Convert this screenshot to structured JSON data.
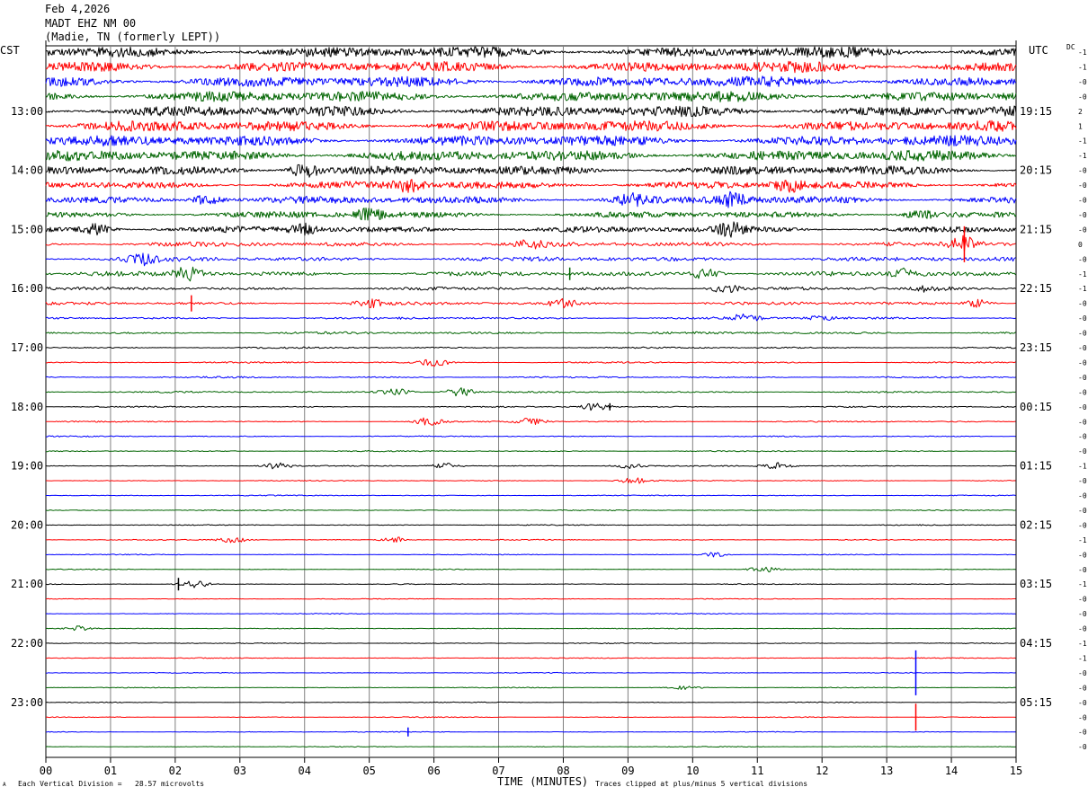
{
  "header": {
    "date": "Feb 4,2026",
    "station": "MADT EHZ NM 00",
    "location": "(Madie, TN (formerly LEPT))"
  },
  "left_zone_label": "CST",
  "right_zone_label": "UTC",
  "dc_label": "DC",
  "footer": {
    "scale_note": "Each Vertical Division =   28.57 microvolts",
    "clip_note": "Traces clipped at plus/minus 5 vertical divisions",
    "corner_mark": "A"
  },
  "colors": {
    "trace_cycle": [
      "#000000",
      "#ff0000",
      "#0000ff",
      "#006400"
    ],
    "grid": "#808080"
  },
  "chart_data": {
    "type": "line",
    "title": "Feb 4,2026 MADT EHZ NM 00 (Madie, TN (formerly LEPT))",
    "xlabel": "TIME (MINUTES)",
    "ylabel": "",
    "x_range": [
      0,
      15
    ],
    "x_tick_labels": [
      "00",
      "01",
      "02",
      "03",
      "04",
      "05",
      "06",
      "07",
      "08",
      "09",
      "10",
      "11",
      "12",
      "13",
      "14",
      "15"
    ],
    "grid": true,
    "traces_per_hour": 4,
    "minutes_per_trace": 15,
    "left_hour_labels": [
      "13:00",
      "14:00",
      "15:00",
      "16:00",
      "17:00",
      "18:00",
      "19:00",
      "20:00",
      "21:00",
      "22:00",
      "23:00"
    ],
    "right_hour_labels": [
      "19:15",
      "20:15",
      "21:15",
      "22:15",
      "23:15",
      "00:15",
      "01:15",
      "02:15",
      "03:15",
      "04:15",
      "05:15"
    ],
    "first_labeled_trace": 4,
    "dc_offsets": [
      "-1",
      "-1",
      "-0",
      "-0",
      "2",
      "1",
      "-1",
      "-1",
      "-0",
      "-0",
      "-0",
      "-0",
      "-0",
      "0",
      "-0",
      "-1",
      "-1",
      "-0",
      "-0",
      "-0",
      "-0",
      "-0",
      "-0",
      "-0",
      "-0",
      "-0",
      "-0",
      "-0",
      "-1",
      "-0",
      "-0",
      "-0",
      "-0",
      "-1",
      "-0",
      "-0",
      "-1",
      "-0",
      "-0",
      "-0",
      "-1",
      "-1",
      "-0",
      "-0",
      "-0",
      "-0",
      "-0",
      "-0"
    ],
    "trace_amplitude": [
      7,
      7,
      7,
      7,
      7,
      7,
      7,
      7,
      6,
      5,
      5,
      4,
      4,
      3,
      3,
      3,
      2,
      2,
      1.5,
      1.5,
      1,
      1,
      1,
      1,
      0.8,
      0.8,
      0.7,
      0.7,
      0.7,
      0.6,
      0.6,
      0.6,
      0.6,
      0.6,
      0.5,
      0.5,
      0.5,
      0.5,
      0.5,
      0.5,
      0.5,
      0.5,
      0.5,
      0.5,
      0.5,
      0.5,
      0.5,
      0.5
    ],
    "events": [
      {
        "trace": 8,
        "minute": 4.0,
        "amplitude": 8
      },
      {
        "trace": 9,
        "minute": 5.6,
        "amplitude": 6
      },
      {
        "trace": 9,
        "minute": 11.5,
        "amplitude": 6
      },
      {
        "trace": 10,
        "minute": 2.5,
        "amplitude": 6
      },
      {
        "trace": 10,
        "minute": 9.0,
        "amplitude": 6
      },
      {
        "trace": 10,
        "minute": 10.6,
        "amplitude": 7
      },
      {
        "trace": 11,
        "minute": 5.0,
        "amplitude": 6
      },
      {
        "trace": 11,
        "minute": 13.5,
        "amplitude": 5
      },
      {
        "trace": 12,
        "minute": 0.8,
        "amplitude": 6
      },
      {
        "trace": 12,
        "minute": 4.0,
        "amplitude": 5
      },
      {
        "trace": 12,
        "minute": 10.6,
        "amplitude": 6
      },
      {
        "trace": 13,
        "minute": 7.5,
        "amplitude": 4
      },
      {
        "trace": 13,
        "minute": 14.2,
        "amplitude": 8
      },
      {
        "trace": 14,
        "minute": 1.5,
        "amplitude": 5
      },
      {
        "trace": 15,
        "minute": 2.2,
        "amplitude": 7
      },
      {
        "trace": 15,
        "minute": 10.2,
        "amplitude": 6
      },
      {
        "trace": 15,
        "minute": 13.3,
        "amplitude": 5
      },
      {
        "trace": 16,
        "minute": 10.5,
        "amplitude": 5
      },
      {
        "trace": 16,
        "minute": 13.7,
        "amplitude": 4
      },
      {
        "trace": 17,
        "minute": 5.0,
        "amplitude": 4
      },
      {
        "trace": 17,
        "minute": 8.0,
        "amplitude": 4
      },
      {
        "trace": 17,
        "minute": 14.4,
        "amplitude": 4
      },
      {
        "trace": 18,
        "minute": 10.8,
        "amplitude": 4
      },
      {
        "trace": 18,
        "minute": 12.0,
        "amplitude": 3
      },
      {
        "trace": 21,
        "minute": 6.0,
        "amplitude": 4
      },
      {
        "trace": 23,
        "minute": 5.4,
        "amplitude": 5
      },
      {
        "trace": 23,
        "minute": 6.4,
        "amplitude": 5
      },
      {
        "trace": 24,
        "minute": 8.5,
        "amplitude": 4
      },
      {
        "trace": 25,
        "minute": 5.9,
        "amplitude": 4
      },
      {
        "trace": 25,
        "minute": 7.5,
        "amplitude": 4
      },
      {
        "trace": 28,
        "minute": 3.6,
        "amplitude": 4
      },
      {
        "trace": 28,
        "minute": 6.2,
        "amplitude": 3
      },
      {
        "trace": 28,
        "minute": 9.0,
        "amplitude": 3
      },
      {
        "trace": 28,
        "minute": 11.3,
        "amplitude": 4
      },
      {
        "trace": 29,
        "minute": 9.1,
        "amplitude": 3
      },
      {
        "trace": 33,
        "minute": 2.9,
        "amplitude": 3
      },
      {
        "trace": 33,
        "minute": 5.4,
        "amplitude": 3
      },
      {
        "trace": 34,
        "minute": 10.3,
        "amplitude": 3
      },
      {
        "trace": 35,
        "minute": 11.1,
        "amplitude": 3
      },
      {
        "trace": 36,
        "minute": 2.3,
        "amplitude": 4
      },
      {
        "trace": 39,
        "minute": 0.5,
        "amplitude": 3
      },
      {
        "trace": 43,
        "minute": 9.9,
        "amplitude": 2
      }
    ],
    "spikes": [
      {
        "trace": 13,
        "minute": 14.2,
        "height": 40
      },
      {
        "trace": 15,
        "minute": 8.1,
        "height": 14
      },
      {
        "trace": 17,
        "minute": 2.25,
        "height": 18
      },
      {
        "trace": 24,
        "minute": 8.72,
        "height": 8
      },
      {
        "trace": 36,
        "minute": 2.05,
        "height": 14
      },
      {
        "trace": 42,
        "minute": 13.45,
        "height": 50
      },
      {
        "trace": 45,
        "minute": 13.45,
        "height": 30
      },
      {
        "trace": 46,
        "minute": 5.6,
        "height": 10
      }
    ]
  }
}
